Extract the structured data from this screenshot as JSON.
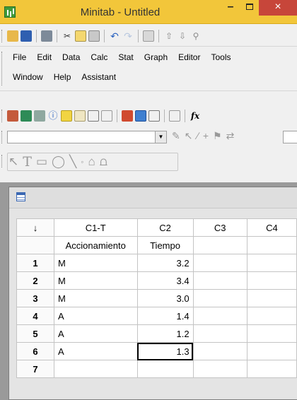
{
  "window": {
    "title": "Minitab - Untitled",
    "minimize_glyph": "–",
    "close_glyph": "×"
  },
  "menu": {
    "row1": [
      {
        "label": "File"
      },
      {
        "label": "Edit"
      },
      {
        "label": "Data"
      },
      {
        "label": "Calc"
      },
      {
        "label": "Stat"
      },
      {
        "label": "Graph"
      },
      {
        "label": "Editor"
      },
      {
        "label": "Tools"
      }
    ],
    "row2": [
      {
        "label": "Window"
      },
      {
        "label": "Help"
      },
      {
        "label": "Assistant"
      }
    ]
  },
  "toolbar": {
    "standard_icons": [
      "open-icon",
      "save-icon",
      "print-icon",
      "cut-icon",
      "copy-icon",
      "paste-icon",
      "undo-icon",
      "redo-icon",
      "worksheet-icon",
      "up-icon",
      "down-icon",
      "find-icon"
    ],
    "formula_glyph": "fx"
  },
  "worksheet": {
    "corner_glyph": "↓",
    "columns": [
      "C1-T",
      "C2",
      "C3",
      "C4"
    ],
    "names": [
      "Accionamiento",
      "Tiempo",
      "",
      ""
    ],
    "rows": [
      {
        "n": "1",
        "c1": "M",
        "c2": "3.2"
      },
      {
        "n": "2",
        "c1": "M",
        "c2": "3.4"
      },
      {
        "n": "3",
        "c1": "M",
        "c2": "3.0"
      },
      {
        "n": "4",
        "c1": "A",
        "c2": "1.4"
      },
      {
        "n": "5",
        "c1": "A",
        "c2": "1.2"
      },
      {
        "n": "6",
        "c1": "A",
        "c2": "1.3"
      },
      {
        "n": "7",
        "c1": "",
        "c2": ""
      }
    ],
    "selected_cell": "row 6, C2"
  },
  "colors": {
    "titlebar": "#f2c63a",
    "close_button": "#c7463a",
    "mdi_background": "#9a9a9a"
  }
}
